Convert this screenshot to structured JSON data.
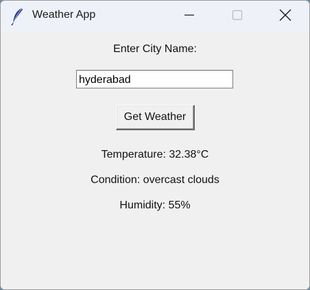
{
  "window": {
    "title": "Weather App",
    "icons": {
      "app": "feather-icon",
      "minimize": "minimize-icon",
      "maximize": "maximize-icon",
      "close": "close-icon"
    }
  },
  "form": {
    "city_label": "Enter City Name:",
    "city_value": "hyderabad",
    "button_label": "Get Weather"
  },
  "results": {
    "temperature": "Temperature: 32.38°C",
    "condition": "Condition: overcast clouds",
    "humidity": "Humidity: 55%"
  }
}
